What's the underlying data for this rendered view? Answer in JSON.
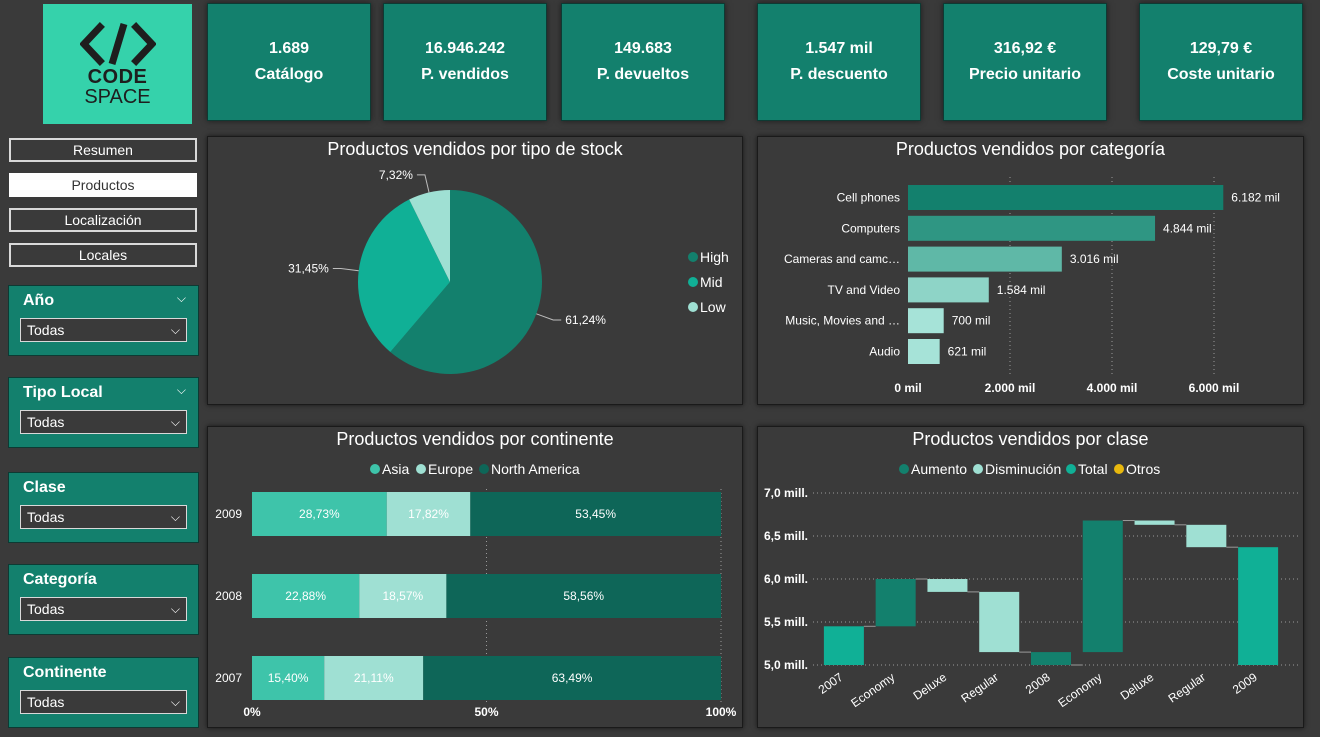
{
  "logo": {
    "line1": "CODE",
    "line2": "SPACE",
    "glyph": "</>"
  },
  "kpis": [
    {
      "value": "1.689",
      "label": "Catálogo"
    },
    {
      "value": "16.946.242",
      "label": "P. vendidos"
    },
    {
      "value": "149.683",
      "label": "P. devueltos"
    },
    {
      "value": "1.547 mil",
      "label": "P. descuento"
    },
    {
      "value": "316,92 €",
      "label": "Precio unitario"
    },
    {
      "value": "129,79 €",
      "label": "Coste unitario"
    }
  ],
  "nav": [
    {
      "label": "Resumen",
      "active": false
    },
    {
      "label": "Productos",
      "active": true
    },
    {
      "label": "Localización",
      "active": false
    },
    {
      "label": "Locales",
      "active": false
    }
  ],
  "slicers": [
    {
      "title": "Año",
      "value": "Todas",
      "chevron": true
    },
    {
      "title": "Tipo Local",
      "value": "Todas",
      "chevron": true
    },
    {
      "title": "Clase",
      "value": "Todas",
      "chevron": false
    },
    {
      "title": "Categoría",
      "value": "Todas",
      "chevron": false
    },
    {
      "title": "Continente",
      "value": "Todas",
      "chevron": false
    }
  ],
  "colors": {
    "accent": "#13806d",
    "logo_bg": "#35d2ab",
    "dark_teal": "#14806e",
    "mid_teal": "#0fb096",
    "light_teal": "#98ddd0"
  },
  "chart_data": [
    {
      "type": "pie",
      "title": "Productos vendidos por tipo de stock",
      "legend_position": "right",
      "slices": [
        {
          "name": "High",
          "value": 61.24,
          "label": "61,24%",
          "color": "#13806d"
        },
        {
          "name": "Mid",
          "value": 31.45,
          "label": "31,45%",
          "color": "#10b096"
        },
        {
          "name": "Low",
          "value": 7.32,
          "label": "7,32%",
          "color": "#9fe0d3"
        }
      ]
    },
    {
      "type": "bar",
      "orientation": "horizontal",
      "title": "Productos vendidos por categoría",
      "categories": [
        "Cell phones",
        "Computers",
        "Cameras and camc…",
        "TV and Video",
        "Music, Movies and …",
        "Audio"
      ],
      "values": [
        6182,
        4844,
        3016,
        1584,
        700,
        621
      ],
      "value_labels": [
        "6.182 mil",
        "4.844 mil",
        "3.016 mil",
        "1.584 mil",
        "700 mil",
        "621 mil"
      ],
      "bar_colors": [
        "#13806d",
        "#2f9683",
        "#5fb8a7",
        "#8ed4c7",
        "#a6e3d8",
        "#a6e3d8"
      ],
      "xlim": [
        0,
        6500
      ],
      "xticks": [
        0,
        2000,
        4000,
        6000
      ],
      "xtick_labels": [
        "0 mil",
        "2.000 mil",
        "4.000 mil",
        "6.000 mil"
      ],
      "grid": true
    },
    {
      "type": "bar",
      "orientation": "horizontal",
      "stacked": "100%",
      "title": "Productos vendidos por continente",
      "legend_position": "top",
      "categories": [
        "2009",
        "2008",
        "2007"
      ],
      "series": [
        {
          "name": "Asia",
          "values": [
            28.73,
            22.88,
            15.4
          ],
          "labels": [
            "28,73%",
            "22,88%",
            "15,40%"
          ],
          "color": "#3ec4aa"
        },
        {
          "name": "Europe",
          "values": [
            17.82,
            18.57,
            21.11
          ],
          "labels": [
            "17,82%",
            "18,57%",
            "21,11%"
          ],
          "color": "#9fe0d3"
        },
        {
          "name": "North America",
          "values": [
            53.45,
            58.56,
            63.49
          ],
          "labels": [
            "53,45%",
            "58,56%",
            "63,49%"
          ],
          "color": "#0e6658"
        }
      ],
      "xticks": [
        0,
        50,
        100
      ],
      "xtick_labels": [
        "0%",
        "50%",
        "100%"
      ],
      "grid": true
    },
    {
      "type": "waterfall",
      "title": "Productos vendidos por clase",
      "legend_position": "top",
      "legend": [
        {
          "name": "Aumento",
          "color": "#13806d"
        },
        {
          "name": "Disminución",
          "color": "#9fe0d3"
        },
        {
          "name": "Total",
          "color": "#10b096"
        },
        {
          "name": "Otros",
          "color": "#e8b80e"
        }
      ],
      "categories": [
        "2007",
        "Economy",
        "Deluxe",
        "Regular",
        "2008",
        "Economy",
        "Deluxe",
        "Regular",
        "2009"
      ],
      "steps": [
        {
          "kind": "Total",
          "from": 5.0,
          "to": 5.45
        },
        {
          "kind": "Aumento",
          "from": 5.45,
          "to": 6.0
        },
        {
          "kind": "Disminución",
          "from": 6.0,
          "to": 5.85
        },
        {
          "kind": "Disminución",
          "from": 5.85,
          "to": 5.15
        },
        {
          "kind": "Aumento",
          "from": 5.15,
          "to": 5.0
        },
        {
          "kind": "Aumento",
          "from": 5.15,
          "to": 6.68
        },
        {
          "kind": "Disminución",
          "from": 6.68,
          "to": 6.63
        },
        {
          "kind": "Disminución",
          "from": 6.63,
          "to": 6.37
        },
        {
          "kind": "Total",
          "from": 5.0,
          "to": 6.37
        }
      ],
      "ylim": [
        5.0,
        7.0
      ],
      "yticks": [
        5.0,
        5.5,
        6.0,
        6.5,
        7.0
      ],
      "ytick_labels": [
        "5,0 mill.",
        "5,5 mill.",
        "6,0 mill.",
        "6,5 mill.",
        "7,0 mill."
      ],
      "grid": true
    }
  ]
}
